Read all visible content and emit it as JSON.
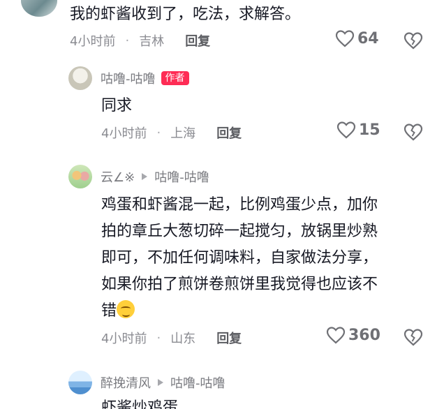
{
  "comments": [
    {
      "text": "我的虾酱收到了，吃法，求解答。",
      "time": "4小时前",
      "location": "吉林",
      "reply_label": "回复",
      "likes": "64"
    },
    {
      "author": "咕噜-咕噜",
      "badge": "作者",
      "text": "同求",
      "time": "4小时前",
      "location": "上海",
      "reply_label": "回复",
      "likes": "15"
    },
    {
      "author": "云∠※",
      "reply_to": "咕噜-咕噜",
      "text_lines": [
        "鸡蛋和虾酱混一起，比例鸡蛋少点，加你",
        "拍的章丘大葱切碎一起搅匀，放锅里炒熟",
        "即可，不加任何调味料，自家做法分享，",
        "如果你拍了煎饼卷煎饼里我觉得也应该不",
        "错"
      ],
      "emoji": "smirk-emoji",
      "time": "4小时前",
      "location": "山东",
      "reply_label": "回复",
      "likes": "360"
    },
    {
      "author": "醉挽清风",
      "reply_to": "咕噜-咕噜",
      "text": "虾酱炒鸡蛋"
    }
  ],
  "separator": "·",
  "icons": {
    "like": "heart-outline-icon",
    "dislike": "broken-heart-icon"
  },
  "colors": {
    "badge": "#fe2c55",
    "text": "#161823",
    "meta": "#8a8b91"
  }
}
